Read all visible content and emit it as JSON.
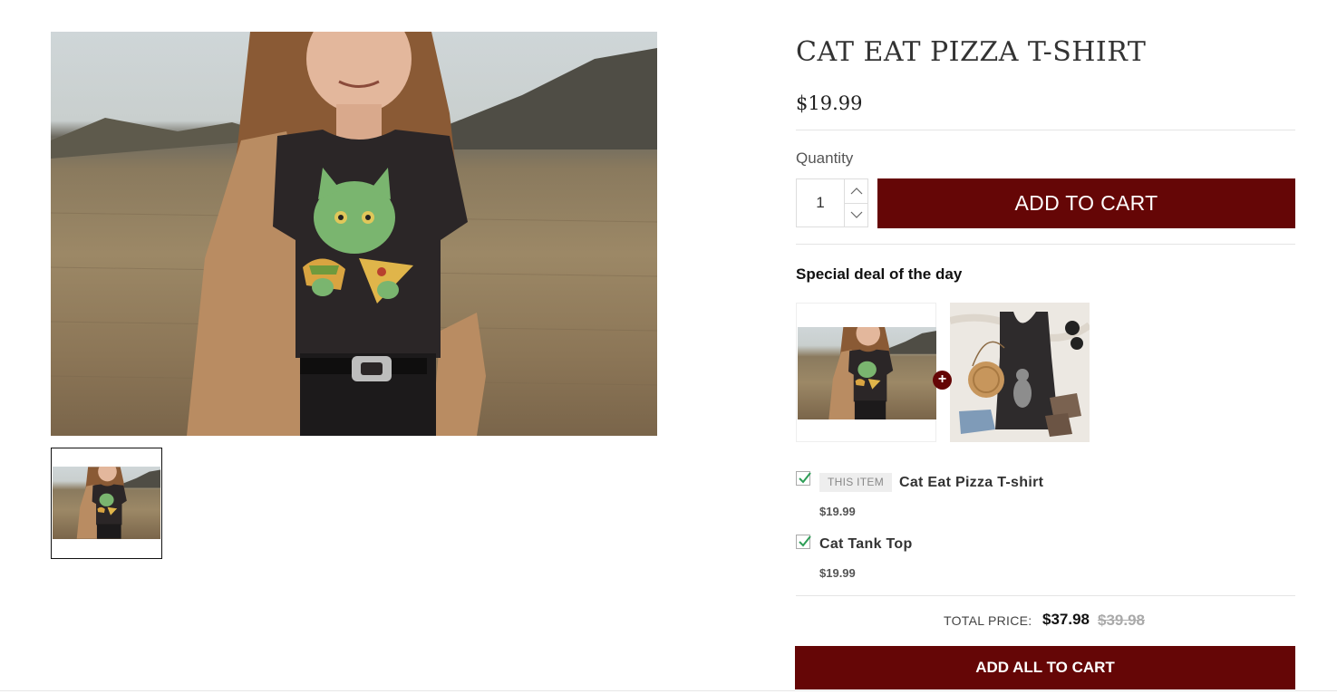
{
  "product": {
    "title": "CAT EAT PIZZA T-SHIRT",
    "price": "$19.99",
    "quantity_label": "Quantity",
    "quantity_value": "1",
    "add_to_cart_label": "ADD TO CART"
  },
  "deal": {
    "heading": "Special deal of the day",
    "plus_symbol": "+",
    "items": [
      {
        "badge": "THIS ITEM",
        "name": "Cat Eat Pizza T-shirt",
        "price": "$19.99",
        "checked": true
      },
      {
        "name": "Cat Tank Top",
        "price": "$19.99",
        "checked": true
      }
    ],
    "total_label": "TOTAL PRICE:",
    "total_price": "$37.98",
    "total_original": "$39.98",
    "add_all_label": "ADD ALL TO CART"
  },
  "colors": {
    "accent": "#650606",
    "check": "#2e9e57",
    "divider": "#e4e4e4"
  },
  "icons": [
    "chevron-up-icon",
    "chevron-down-icon",
    "plus-icon",
    "checkmark-icon"
  ]
}
